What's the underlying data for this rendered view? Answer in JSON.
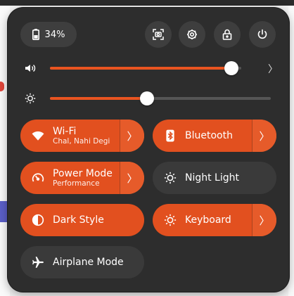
{
  "battery": {
    "percent_label": "34%",
    "icon": "battery-icon"
  },
  "top_buttons": [
    {
      "name": "screenshot-button",
      "icon": "screenshot-icon"
    },
    {
      "name": "settings-button",
      "icon": "gear-icon"
    },
    {
      "name": "lock-button",
      "icon": "lock-icon"
    },
    {
      "name": "power-button",
      "icon": "power-icon"
    }
  ],
  "volume": {
    "icon": "speaker-icon",
    "level": 0.95,
    "chevron": "〉"
  },
  "brightness": {
    "icon": "sun-icon",
    "level": 0.44
  },
  "tiles": {
    "wifi": {
      "title": "Wi-Fi",
      "subtitle": "Chal, Nahi Degi",
      "active": true,
      "arrow": "〉"
    },
    "bluetooth": {
      "title": "Bluetooth",
      "active": true,
      "arrow": "〉"
    },
    "power_mode": {
      "title": "Power Mode",
      "subtitle": "Performance",
      "active": true,
      "arrow": "〉"
    },
    "night_light": {
      "title": "Night Light",
      "active": false
    },
    "dark_style": {
      "title": "Dark Style",
      "active": true
    },
    "keyboard": {
      "title": "Keyboard",
      "active": true,
      "arrow": "〉"
    },
    "airplane": {
      "title": "Airplane Mode",
      "active": false
    }
  },
  "colors": {
    "accent": "#e2501f",
    "panel": "#2d2d2d",
    "inactive_tile": "#4a4a4a"
  }
}
